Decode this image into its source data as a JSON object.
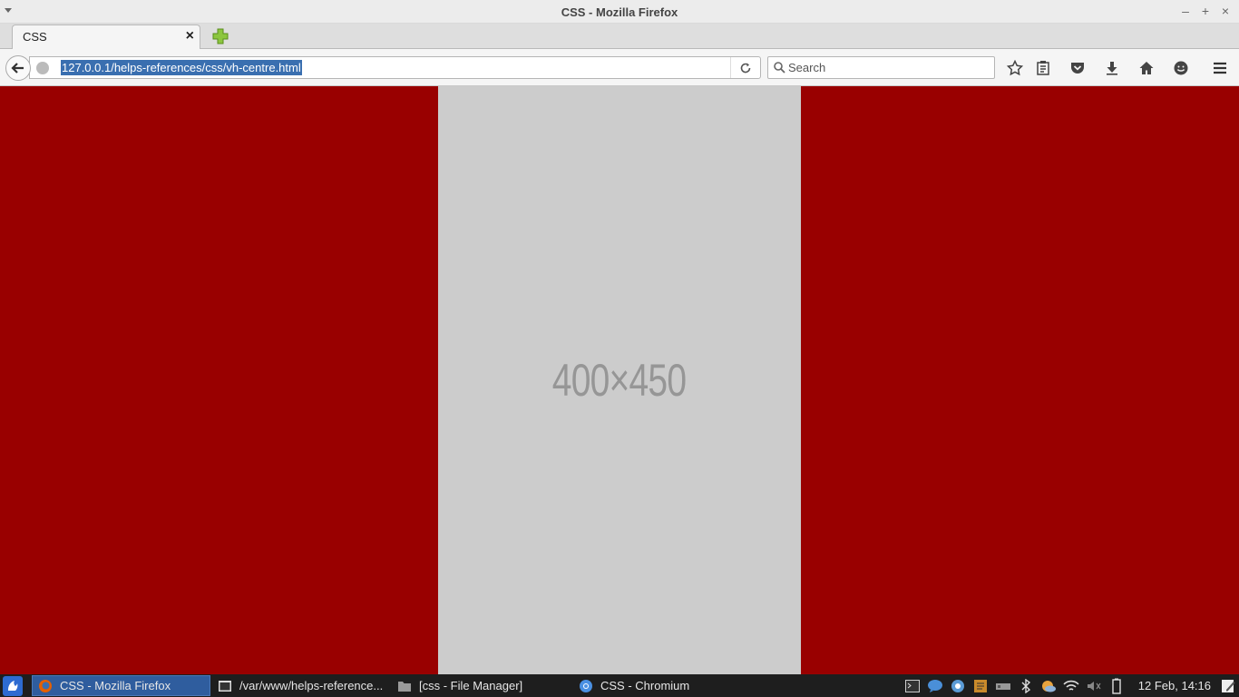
{
  "window": {
    "title": "CSS - Mozilla Firefox"
  },
  "tabs": [
    {
      "label": "CSS"
    }
  ],
  "navbar": {
    "url": "127.0.0.1/helps-references/css/vh-centre.html",
    "search_placeholder": "Search"
  },
  "content": {
    "background_color": "#990000",
    "placeholder_color": "#cccccc",
    "placeholder_text": "400×450"
  },
  "taskbar": {
    "tasks": [
      {
        "label": "CSS - Mozilla Firefox",
        "icon": "firefox-icon",
        "active": true
      },
      {
        "label": "/var/www/helps-reference...",
        "icon": "terminal-window-icon",
        "active": false
      },
      {
        "label": "[css - File Manager]",
        "icon": "folder-icon",
        "active": false
      },
      {
        "label": "CSS - Chromium",
        "icon": "chromium-icon",
        "active": false
      }
    ],
    "clock": "12 Feb, 14:16"
  }
}
